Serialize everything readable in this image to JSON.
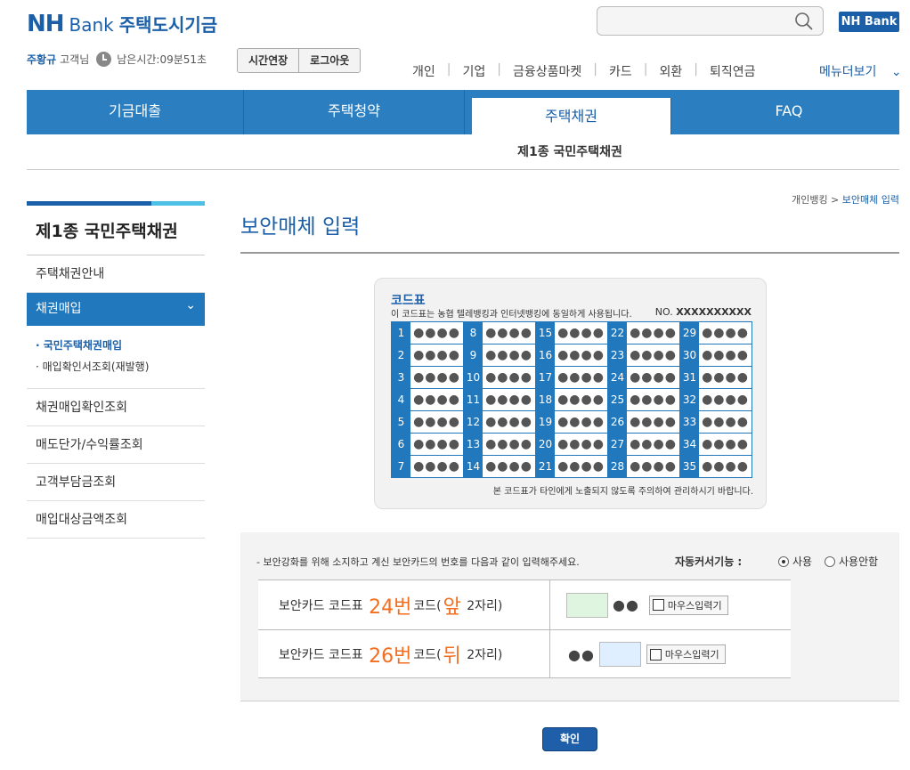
{
  "header": {
    "logo_nh": "NH",
    "logo_bank": "Bank",
    "logo_title": "주택도시기금",
    "nh_bank_badge": "NH Bank"
  },
  "user": {
    "name": "주황규",
    "suffix": "고객님",
    "remaining_time": "남은시간:09분51초",
    "extend_button": "시간연장",
    "logout_button": "로그아웃"
  },
  "topnav": [
    "개인",
    "기업",
    "금융상품마켓",
    "카드",
    "외환",
    "퇴직연금"
  ],
  "menu_more": "메뉴더보기",
  "tabs": [
    "기금대출",
    "주택청약",
    "주택채권",
    "FAQ"
  ],
  "subtab": "제1종 국민주택채권",
  "sidebar": {
    "title": "제1종 국민주택채권",
    "items": [
      "주택채권안내",
      "채권매입",
      "채권매입확인조회",
      "매도단가/수익률조회",
      "고객부담금조회",
      "매입대상금액조회"
    ],
    "subitems": [
      "· 국민주택채권매입",
      "· 매입확인서조회(재발행)"
    ]
  },
  "breadcrumb": {
    "parent": "개인뱅킹",
    "current": "보안매체 입력"
  },
  "page_title": "보안매체 입력",
  "code_card": {
    "title": "코드표",
    "subtitle": "이 코드표는 농협 텔레뱅킹과 인터넷뱅킹에 동일하게 사용됩니다.",
    "no_label": "NO.",
    "no_value": "XXXXXXXXXX",
    "masked": "●●●●",
    "warning": "본 코드표가 타인에게 노출되지 않도록 주의하여 관리하시기 바랍니다."
  },
  "form": {
    "hint": "- 보안강화를 위해 소지하고 계신 보안카드의 번호를 다음과 같이 입력해주세요.",
    "auto_cursor_label": "자동커서기능 :",
    "radio_use": "사용",
    "radio_nouse": "사용안함",
    "rows": [
      {
        "prefix": "보안카드 코드표",
        "num": "24번",
        "mid": "코드(",
        "side": "앞",
        "suffix": "2자리)"
      },
      {
        "prefix": "보안카드 코드표",
        "num": "26번",
        "mid": "코드(",
        "side": "뒤",
        "suffix": "2자리)"
      }
    ],
    "dots": "●●",
    "mouse_input": "마우스입력기"
  },
  "confirm_button": "확인"
}
